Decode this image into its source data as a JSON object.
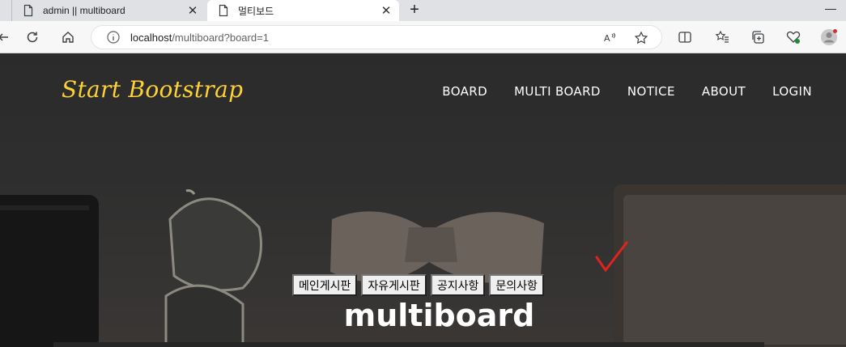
{
  "browser": {
    "tabs": [
      {
        "title": "admin || multiboard",
        "close": "✕"
      },
      {
        "title": "멀티보드",
        "close": "✕"
      }
    ],
    "new_tab": "+",
    "minimize": "—",
    "url_host": "localhost",
    "url_path": "/multiboard?board=1"
  },
  "site": {
    "brand": "Start Bootstrap",
    "brand_color": "#fed136",
    "nav": [
      "BOARD",
      "MULTI BOARD",
      "NOTICE",
      "ABOUT",
      "LOGIN"
    ],
    "board_buttons": [
      "메인게시판",
      "자유게시판",
      "공지사항",
      "문의사항"
    ],
    "headline": "multiboard"
  }
}
